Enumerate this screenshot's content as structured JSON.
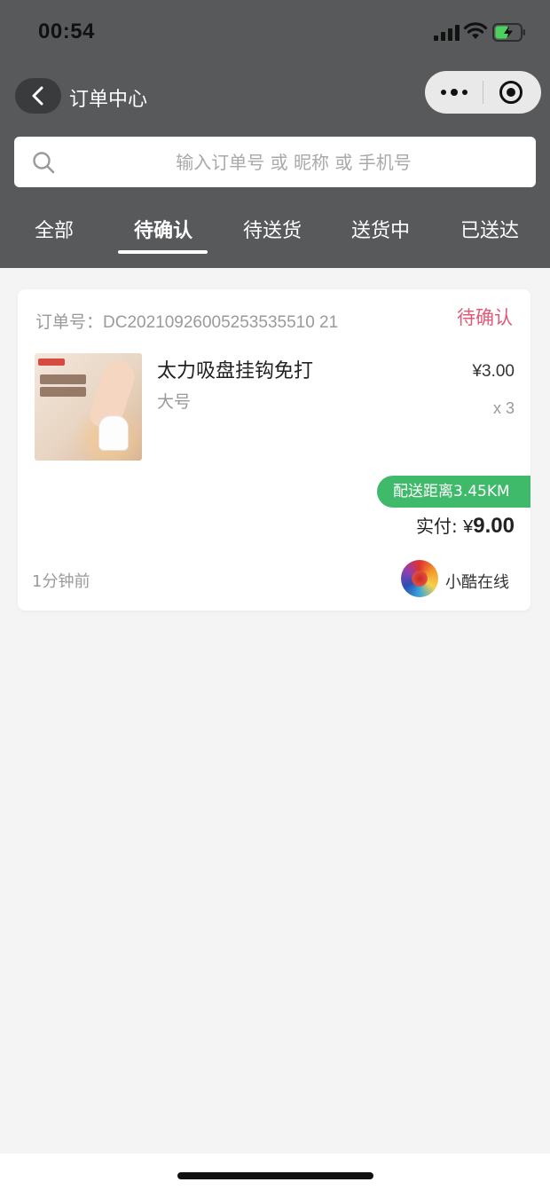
{
  "status_bar": {
    "time": "00:54",
    "icons": [
      "cellular-signal-icon",
      "wifi-icon",
      "battery-charging-icon"
    ]
  },
  "nav": {
    "title": "订单中心",
    "back_icon": "chevron-left-icon",
    "capsule_icons": [
      "more-dots-icon",
      "target-icon"
    ]
  },
  "search": {
    "placeholder": "输入订单号 或 昵称 或 手机号",
    "value": ""
  },
  "tabs": [
    {
      "label": "全部",
      "active": false
    },
    {
      "label": "待确认",
      "active": true
    },
    {
      "label": "待送货",
      "active": false
    },
    {
      "label": "送货中",
      "active": false
    },
    {
      "label": "已送达",
      "active": false
    }
  ],
  "orders": [
    {
      "order_no": "订单号：DC20210926005253535510 21",
      "status": "待确认",
      "product": {
        "name": "太力吸盘挂钩免打",
        "spec": "大号",
        "price": "¥3.00",
        "quantity": "x 3"
      },
      "distance": "配送距离3.45KM",
      "paid_label": "实付:",
      "paid_currency": "¥",
      "paid_amount": "9.00",
      "time_ago": "1分钟前",
      "shop_name": "小酷在线"
    }
  ],
  "colors": {
    "header_bg": "#58595b",
    "status_pending": "#e05a78",
    "distance_badge": "#3fb96a",
    "page_bg": "#f4f4f4"
  }
}
